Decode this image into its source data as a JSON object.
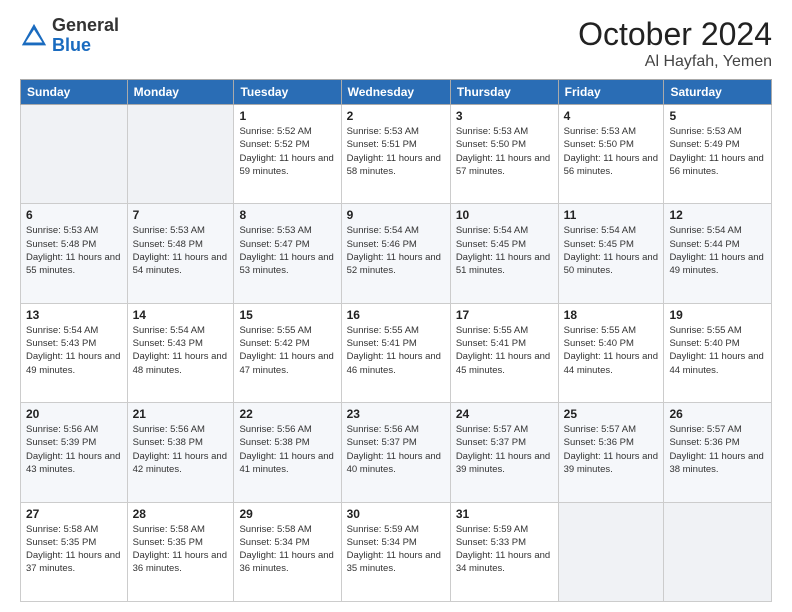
{
  "header": {
    "logo_general": "General",
    "logo_blue": "Blue",
    "month_title": "October 2024",
    "location": "Al Hayfah, Yemen"
  },
  "weekdays": [
    "Sunday",
    "Monday",
    "Tuesday",
    "Wednesday",
    "Thursday",
    "Friday",
    "Saturday"
  ],
  "weeks": [
    [
      {
        "day": "",
        "detail": ""
      },
      {
        "day": "",
        "detail": ""
      },
      {
        "day": "1",
        "detail": "Sunrise: 5:52 AM\nSunset: 5:52 PM\nDaylight: 11 hours and 59 minutes."
      },
      {
        "day": "2",
        "detail": "Sunrise: 5:53 AM\nSunset: 5:51 PM\nDaylight: 11 hours and 58 minutes."
      },
      {
        "day": "3",
        "detail": "Sunrise: 5:53 AM\nSunset: 5:50 PM\nDaylight: 11 hours and 57 minutes."
      },
      {
        "day": "4",
        "detail": "Sunrise: 5:53 AM\nSunset: 5:50 PM\nDaylight: 11 hours and 56 minutes."
      },
      {
        "day": "5",
        "detail": "Sunrise: 5:53 AM\nSunset: 5:49 PM\nDaylight: 11 hours and 56 minutes."
      }
    ],
    [
      {
        "day": "6",
        "detail": "Sunrise: 5:53 AM\nSunset: 5:48 PM\nDaylight: 11 hours and 55 minutes."
      },
      {
        "day": "7",
        "detail": "Sunrise: 5:53 AM\nSunset: 5:48 PM\nDaylight: 11 hours and 54 minutes."
      },
      {
        "day": "8",
        "detail": "Sunrise: 5:53 AM\nSunset: 5:47 PM\nDaylight: 11 hours and 53 minutes."
      },
      {
        "day": "9",
        "detail": "Sunrise: 5:54 AM\nSunset: 5:46 PM\nDaylight: 11 hours and 52 minutes."
      },
      {
        "day": "10",
        "detail": "Sunrise: 5:54 AM\nSunset: 5:45 PM\nDaylight: 11 hours and 51 minutes."
      },
      {
        "day": "11",
        "detail": "Sunrise: 5:54 AM\nSunset: 5:45 PM\nDaylight: 11 hours and 50 minutes."
      },
      {
        "day": "12",
        "detail": "Sunrise: 5:54 AM\nSunset: 5:44 PM\nDaylight: 11 hours and 49 minutes."
      }
    ],
    [
      {
        "day": "13",
        "detail": "Sunrise: 5:54 AM\nSunset: 5:43 PM\nDaylight: 11 hours and 49 minutes."
      },
      {
        "day": "14",
        "detail": "Sunrise: 5:54 AM\nSunset: 5:43 PM\nDaylight: 11 hours and 48 minutes."
      },
      {
        "day": "15",
        "detail": "Sunrise: 5:55 AM\nSunset: 5:42 PM\nDaylight: 11 hours and 47 minutes."
      },
      {
        "day": "16",
        "detail": "Sunrise: 5:55 AM\nSunset: 5:41 PM\nDaylight: 11 hours and 46 minutes."
      },
      {
        "day": "17",
        "detail": "Sunrise: 5:55 AM\nSunset: 5:41 PM\nDaylight: 11 hours and 45 minutes."
      },
      {
        "day": "18",
        "detail": "Sunrise: 5:55 AM\nSunset: 5:40 PM\nDaylight: 11 hours and 44 minutes."
      },
      {
        "day": "19",
        "detail": "Sunrise: 5:55 AM\nSunset: 5:40 PM\nDaylight: 11 hours and 44 minutes."
      }
    ],
    [
      {
        "day": "20",
        "detail": "Sunrise: 5:56 AM\nSunset: 5:39 PM\nDaylight: 11 hours and 43 minutes."
      },
      {
        "day": "21",
        "detail": "Sunrise: 5:56 AM\nSunset: 5:38 PM\nDaylight: 11 hours and 42 minutes."
      },
      {
        "day": "22",
        "detail": "Sunrise: 5:56 AM\nSunset: 5:38 PM\nDaylight: 11 hours and 41 minutes."
      },
      {
        "day": "23",
        "detail": "Sunrise: 5:56 AM\nSunset: 5:37 PM\nDaylight: 11 hours and 40 minutes."
      },
      {
        "day": "24",
        "detail": "Sunrise: 5:57 AM\nSunset: 5:37 PM\nDaylight: 11 hours and 39 minutes."
      },
      {
        "day": "25",
        "detail": "Sunrise: 5:57 AM\nSunset: 5:36 PM\nDaylight: 11 hours and 39 minutes."
      },
      {
        "day": "26",
        "detail": "Sunrise: 5:57 AM\nSunset: 5:36 PM\nDaylight: 11 hours and 38 minutes."
      }
    ],
    [
      {
        "day": "27",
        "detail": "Sunrise: 5:58 AM\nSunset: 5:35 PM\nDaylight: 11 hours and 37 minutes."
      },
      {
        "day": "28",
        "detail": "Sunrise: 5:58 AM\nSunset: 5:35 PM\nDaylight: 11 hours and 36 minutes."
      },
      {
        "day": "29",
        "detail": "Sunrise: 5:58 AM\nSunset: 5:34 PM\nDaylight: 11 hours and 36 minutes."
      },
      {
        "day": "30",
        "detail": "Sunrise: 5:59 AM\nSunset: 5:34 PM\nDaylight: 11 hours and 35 minutes."
      },
      {
        "day": "31",
        "detail": "Sunrise: 5:59 AM\nSunset: 5:33 PM\nDaylight: 11 hours and 34 minutes."
      },
      {
        "day": "",
        "detail": ""
      },
      {
        "day": "",
        "detail": ""
      }
    ]
  ]
}
